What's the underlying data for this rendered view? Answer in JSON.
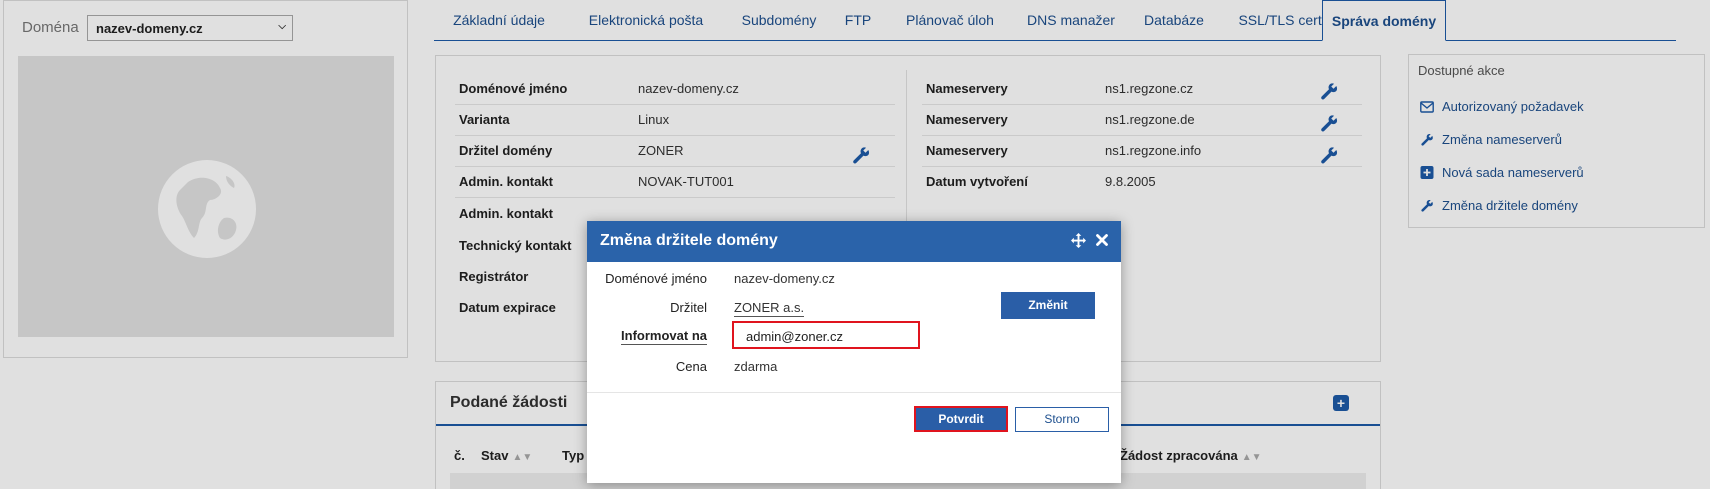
{
  "sidebar": {
    "domain_label": "Doména",
    "domain_select_value": "nazev-domeny.cz"
  },
  "tabs": [
    {
      "label": "Základní údaje",
      "active": false
    },
    {
      "label": "Elektronická pošta",
      "active": false
    },
    {
      "label": "Subdomény",
      "active": false
    },
    {
      "label": "FTP",
      "active": false
    },
    {
      "label": "Plánovač úloh",
      "active": false
    },
    {
      "label": "DNS manažer",
      "active": false
    },
    {
      "label": "Databáze",
      "active": false
    },
    {
      "label": "SSL/TLS certifikáty",
      "active": false
    },
    {
      "label": "Správa domény",
      "active": true
    }
  ],
  "info_left": [
    {
      "label": "Doménové jméno",
      "value": "nazev-domeny.cz"
    },
    {
      "label": "Varianta",
      "value": "Linux"
    },
    {
      "label": "Držitel domény",
      "value": "ZONER"
    },
    {
      "label": "Admin. kontakt",
      "value": "NOVAK-TUT001"
    },
    {
      "label": "Admin. kontakt",
      "value": ""
    },
    {
      "label": "Technický kontakt",
      "value": ""
    },
    {
      "label": "Registrátor",
      "value": ""
    },
    {
      "label": "Datum expirace",
      "value": ""
    }
  ],
  "info_right": [
    {
      "label": "Nameservery",
      "value": "ns1.regzone.cz"
    },
    {
      "label": "Nameservery",
      "value": "ns1.regzone.de"
    },
    {
      "label": "Nameservery",
      "value": "ns1.regzone.info"
    },
    {
      "label": "Datum vytvoření",
      "value": "9.8.2005"
    }
  ],
  "actions": {
    "title": "Dostupné akce",
    "items": [
      {
        "label": "Autorizovaný požadavek",
        "icon": "envelope-icon"
      },
      {
        "label": "Změna nameserverů",
        "icon": "wrench-icon"
      },
      {
        "label": "Nová sada nameserverů",
        "icon": "plus-square-icon"
      },
      {
        "label": "Změna držitele domény",
        "icon": "wrench-icon"
      }
    ]
  },
  "requests": {
    "title": "Podané žádosti",
    "columns": [
      "č.",
      "Stav",
      "Typ",
      "Žádost zpracována"
    ]
  },
  "modal": {
    "title": "Změna držitele domény",
    "domain_label": "Doménové jméno",
    "domain_value": "nazev-domeny.cz",
    "holder_label": "Držitel",
    "holder_value": "ZONER a.s.",
    "change_button": "Změnit",
    "notify_label": "Informovat na",
    "notify_value": "admin@zoner.cz",
    "price_label": "Cena",
    "price_value": "zdarma",
    "confirm_button": "Potvrdit",
    "cancel_button": "Storno"
  },
  "colors": {
    "primary": "#2a5ea7",
    "highlight": "#e0141e"
  }
}
